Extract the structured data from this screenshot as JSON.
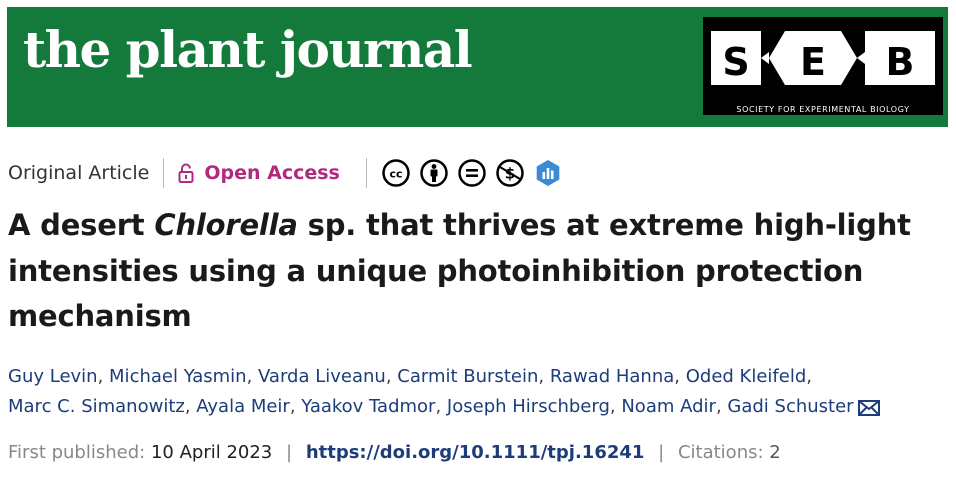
{
  "banner": {
    "journal_title": "the plant journal",
    "seb_letters": [
      "S",
      "E",
      "B"
    ],
    "seb_tagline": "SOCIETY FOR EXPERIMENTAL BIOLOGY",
    "bg_color": "#137a3b"
  },
  "meta": {
    "article_type": "Original Article",
    "open_access_label": "Open Access",
    "open_access_color": "#b12a7f",
    "license_icons": [
      "cc-icon",
      "attribution-icon",
      "no-derivatives-icon",
      "non-commercial-icon",
      "altmetric-icon"
    ]
  },
  "article": {
    "title_part1": "A desert ",
    "title_italic": "Chlorella",
    "title_part2": " sp. that thrives at extreme high-light intensities using a unique photoinhibition protection mechanism"
  },
  "authors": [
    "Guy Levin",
    "Michael Yasmin",
    "Varda Liveanu",
    "Carmit Burstein",
    "Rawad Hanna",
    "Oded Kleifeld",
    "Marc C. Simanowitz",
    "Ayala Meir",
    "Yaakov Tadmor",
    "Joseph Hirschberg",
    "Noam Adir",
    "Gadi Schuster"
  ],
  "publication": {
    "first_published_label": "First published:",
    "first_published_date": "10 April 2023",
    "doi": "https://doi.org/10.1111/tpj.16241",
    "citations_label": "Citations:",
    "citations_count": "2"
  }
}
